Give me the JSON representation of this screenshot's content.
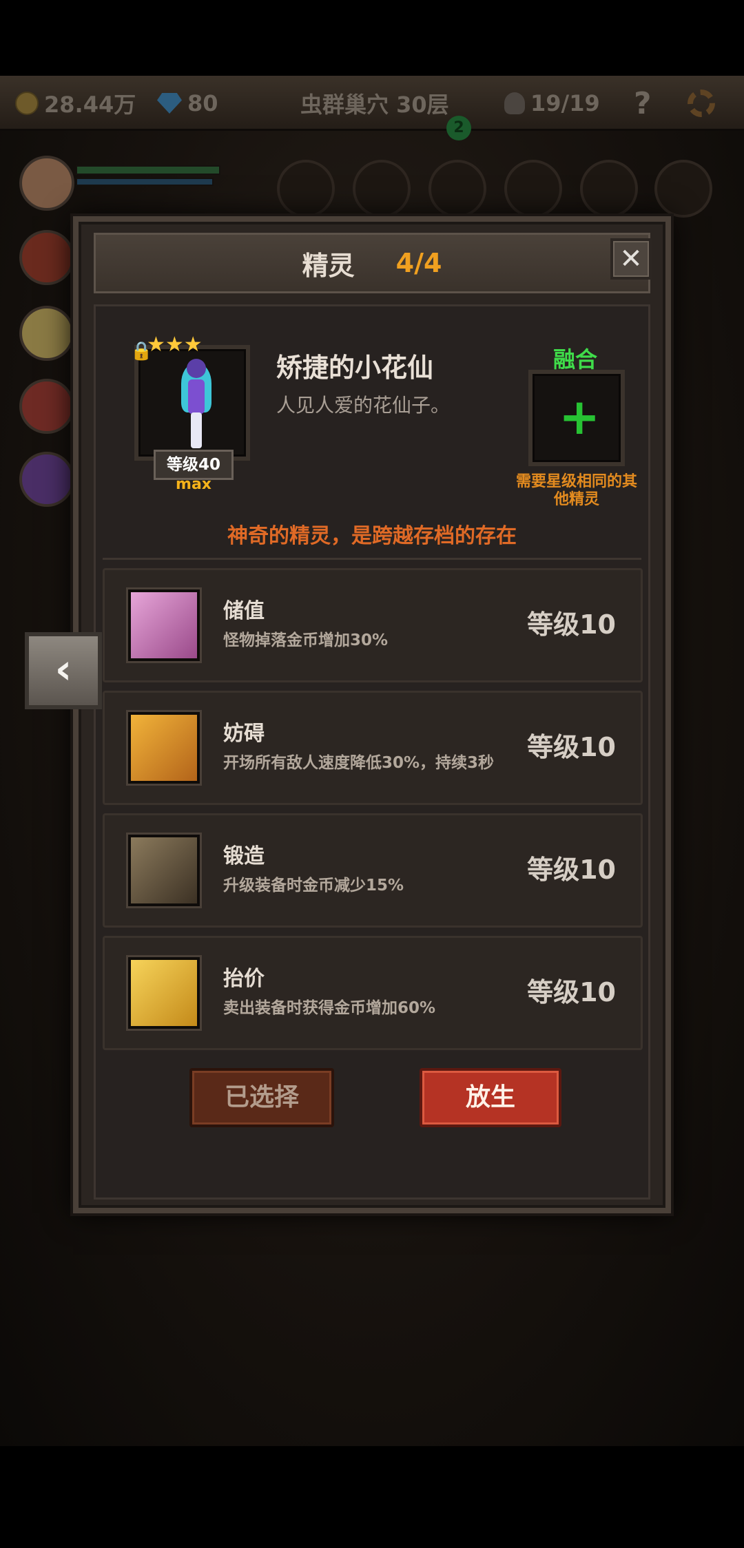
{
  "topbar": {
    "gold": "28.44万",
    "gems": "80",
    "stage": "虫群巢穴 30层",
    "kills": "19/19",
    "help": "?",
    "notification_count": "2"
  },
  "modal": {
    "title": "精灵",
    "count": "4/4",
    "close": "✕",
    "hero": {
      "name": "矫捷的小花仙",
      "description": "人见人爱的花仙子。",
      "stars": "★★★",
      "level_label": "等级40",
      "max_label": "max",
      "fuse_label": "融合",
      "fuse_plus": "+",
      "fuse_hint": "需要星级相同的其他精灵",
      "tagline": "神奇的精灵，是跨越存档的存在"
    },
    "skills": [
      {
        "name": "储值",
        "desc": "怪物掉落金币增加30%",
        "level": "等级10",
        "icon": "goblet-icon",
        "color": "#c87ab8"
      },
      {
        "name": "妨碍",
        "desc": "开场所有敌人速度降低30%，持续3秒",
        "level": "等级10",
        "icon": "chained-boot-icon",
        "color": "#d8931e"
      },
      {
        "name": "锻造",
        "desc": "升级装备时金币减少15%",
        "level": "等级10",
        "icon": "hammer-icon",
        "color": "#6a5a44"
      },
      {
        "name": "抬价",
        "desc": "卖出装备时获得金币增加60%",
        "level": "等级10",
        "icon": "open-hand-icon",
        "color": "#e0b42a"
      }
    ],
    "buttons": {
      "selected": "已选择",
      "release": "放生"
    }
  },
  "back_button": "‹"
}
